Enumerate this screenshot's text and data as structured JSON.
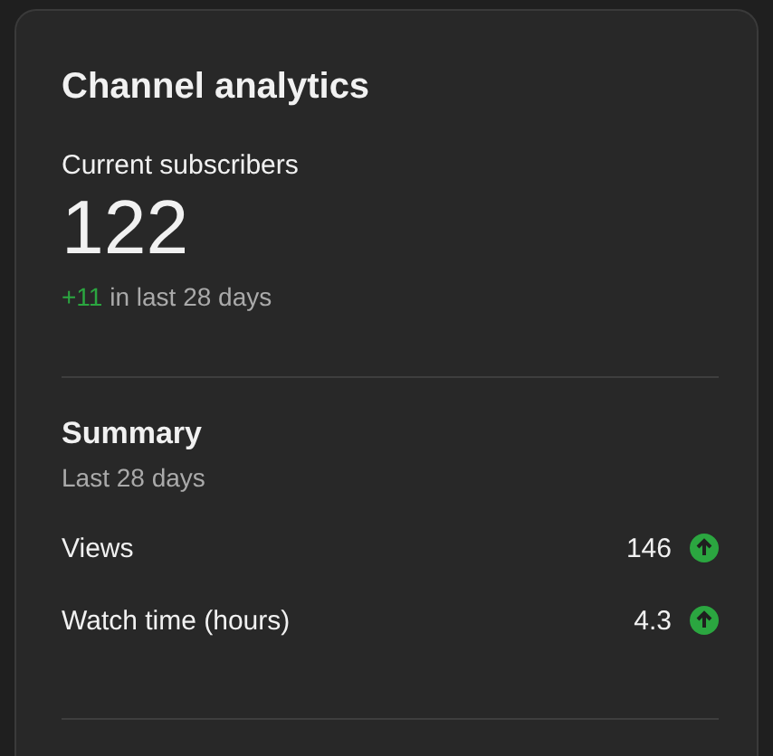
{
  "card": {
    "title": "Channel analytics",
    "subscribers": {
      "label": "Current subscribers",
      "value": "122",
      "change": "+11",
      "change_note": "in last 28 days"
    },
    "summary": {
      "title": "Summary",
      "period": "Last 28 days",
      "metrics": [
        {
          "label": "Views",
          "value": "146",
          "increased": true
        },
        {
          "label": "Watch time (hours)",
          "value": "4.3",
          "increased": true
        }
      ]
    }
  }
}
